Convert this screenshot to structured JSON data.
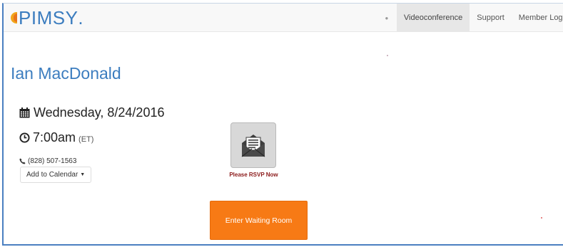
{
  "navbar": {
    "brand": "PIMSY",
    "items": [
      {
        "label": "Videoconference",
        "active": true
      },
      {
        "label": "Support",
        "active": false
      },
      {
        "label": "Member Logi",
        "active": false
      }
    ]
  },
  "main": {
    "title": "Ian MacDonald",
    "date": "Wednesday, 8/24/2016",
    "time": "7:00am",
    "timezone": "(ET)",
    "phone": "(828) 507-1563",
    "add_to_calendar": "Add to Calendar",
    "rsvp_label": "Please RSVP Now",
    "enter_waiting_room": "Enter Waiting Room"
  },
  "colors": {
    "brand_blue": "#3c7dbf",
    "enter_button_orange": "#f77a15",
    "rsvp_text_red": "#8b1a1a"
  },
  "icons": {
    "brand": "pimsy-logo",
    "date": "calendar-icon",
    "time": "clock-icon",
    "phone": "phone-icon",
    "rsvp": "envelope-invite-icon"
  }
}
